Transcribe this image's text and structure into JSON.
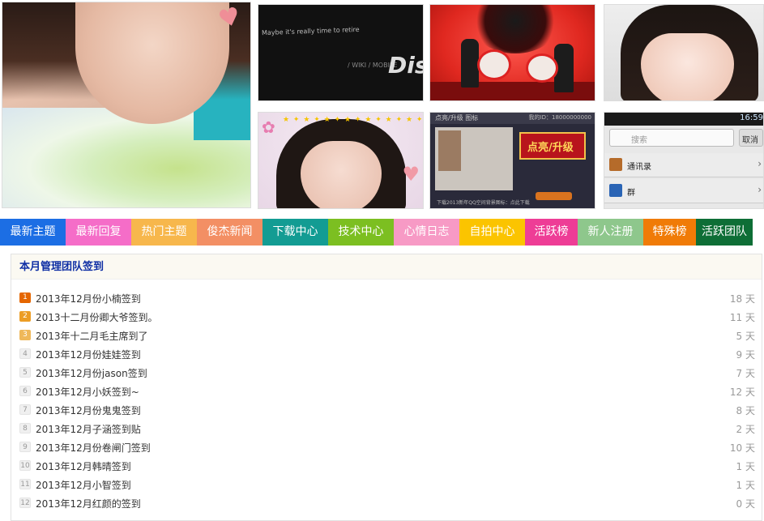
{
  "photos": {
    "discuz_caption_top": "Maybe it's really time to retire",
    "discuz_logo": "Discuz!",
    "discuz_caption_small": "/ WIKI / MOBILE",
    "game_panel_title": "点亮/升级 图标",
    "game_panel_id": "我的ID：18000000000",
    "game_badge": "点亮/升级",
    "game_footer": "下载2013新年QQ空间背景图标：点此下载",
    "phone_time": "16:59",
    "phone_search_placeholder": "搜索",
    "phone_cancel": "取消",
    "phone_row1": "通讯录",
    "phone_row2": "群",
    "stars": "★ ✦ ★ ✦ ★ ✦ ★ ✦ ★ ✦ ★ ✦ ★ ✦ ★"
  },
  "nav": {
    "tabs": [
      {
        "label": "最新主题",
        "color": "#1c6ee4"
      },
      {
        "label": "最新回复",
        "color": "#f56dc8"
      },
      {
        "label": "热门主题",
        "color": "#f7b74c"
      },
      {
        "label": "俊杰新闻",
        "color": "#f38f64"
      },
      {
        "label": "下载中心",
        "color": "#139c93"
      },
      {
        "label": "技术中心",
        "color": "#7cbf21"
      },
      {
        "label": "心情日志",
        "color": "#f79ac5"
      },
      {
        "label": "自拍中心",
        "color": "#fbc400"
      },
      {
        "label": "活跃榜",
        "color": "#ee3d96"
      },
      {
        "label": "新人注册",
        "color": "#8ec78c"
      },
      {
        "label": "特殊榜",
        "color": "#f07b07"
      },
      {
        "label": "活跃团队",
        "color": "#0e6e36"
      }
    ]
  },
  "panel": {
    "title": "本月管理团队签到",
    "items": [
      {
        "rank": "1",
        "title": "2013年12月份小楠签到",
        "days": "18 天"
      },
      {
        "rank": "2",
        "title": "2013十二月份卿大爷签到。",
        "days": "11 天"
      },
      {
        "rank": "3",
        "title": "2013年十二月毛主席到了",
        "days": "5 天"
      },
      {
        "rank": "4",
        "title": "2013年12月份娃娃签到",
        "days": "9 天"
      },
      {
        "rank": "5",
        "title": "2013年12月份jason签到",
        "days": "7 天"
      },
      {
        "rank": "6",
        "title": "2013年12月小妖签到~",
        "days": "12 天"
      },
      {
        "rank": "7",
        "title": "2013年12月份鬼鬼签到",
        "days": "8 天"
      },
      {
        "rank": "8",
        "title": "2013年12月子涵签到贴",
        "days": "2 天"
      },
      {
        "rank": "9",
        "title": "2013年12月份卷闸门签到",
        "days": "10 天"
      },
      {
        "rank": "10",
        "title": "2013年12月韩晴签到",
        "days": "1 天"
      },
      {
        "rank": "11",
        "title": "2013年12月小智签到",
        "days": "1 天"
      },
      {
        "rank": "12",
        "title": "2013年12月红颜的签到",
        "days": "0 天"
      }
    ]
  }
}
